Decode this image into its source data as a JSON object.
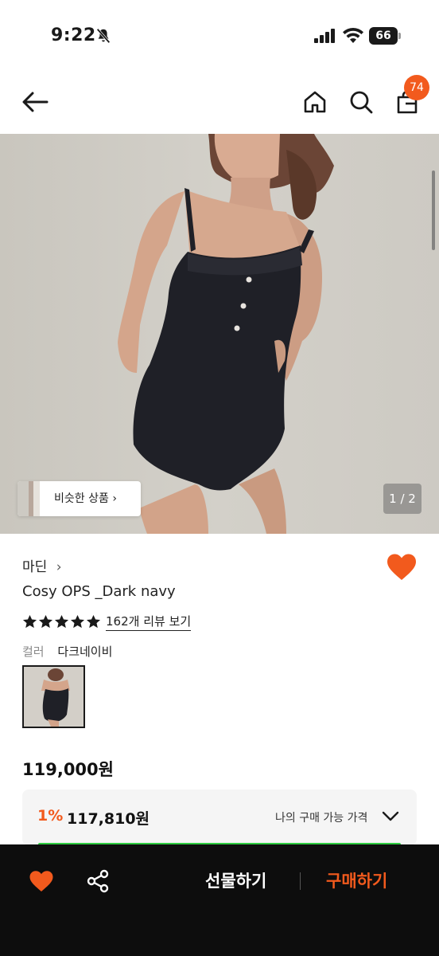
{
  "status_bar": {
    "time": "9:22",
    "battery": "66"
  },
  "nav": {
    "cart_count": "74"
  },
  "gallery": {
    "similar_label": "비슷한 상품",
    "counter": "1 / 2"
  },
  "product": {
    "brand": "마딘",
    "name": "Cosy OPS _Dark navy",
    "rating": 5,
    "review_link": "162개 리뷰 보기",
    "color_label": "컬러",
    "color_value": "다크네이비",
    "price": "119,000원",
    "my_price": {
      "discount": "1%",
      "price": "117,810원",
      "label": "나의 구매 가능 가격"
    }
  },
  "bottom_bar": {
    "gift_label": "선물하기",
    "buy_label": "구매하기"
  },
  "colors": {
    "accent": "#f25a1d",
    "bottom_bar_bg": "#0d0d0d",
    "progress_green": "#2ecc40"
  }
}
